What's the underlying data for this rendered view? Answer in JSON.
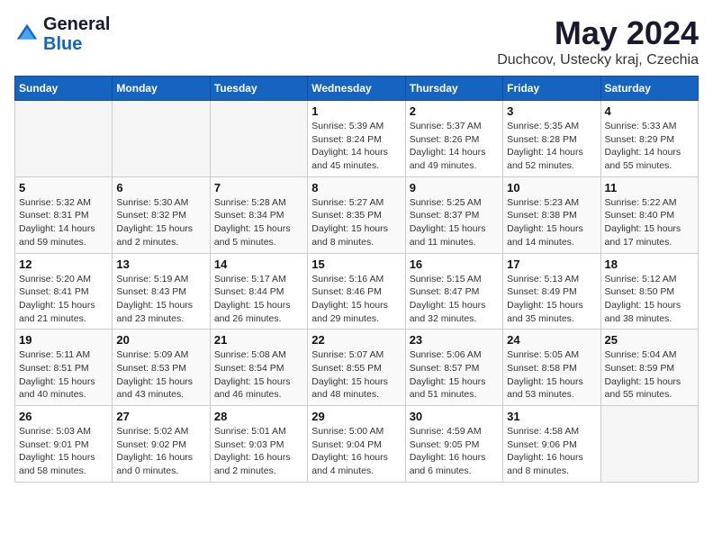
{
  "header": {
    "logo_general": "General",
    "logo_blue": "Blue",
    "month_title": "May 2024",
    "location": "Duchcov, Ustecky kraj, Czechia"
  },
  "weekdays": [
    "Sunday",
    "Monday",
    "Tuesday",
    "Wednesday",
    "Thursday",
    "Friday",
    "Saturday"
  ],
  "weeks": [
    [
      {
        "day": "",
        "sunrise": "",
        "sunset": "",
        "daylight": "",
        "empty": true
      },
      {
        "day": "",
        "sunrise": "",
        "sunset": "",
        "daylight": "",
        "empty": true
      },
      {
        "day": "",
        "sunrise": "",
        "sunset": "",
        "daylight": "",
        "empty": true
      },
      {
        "day": "1",
        "sunrise": "Sunrise: 5:39 AM",
        "sunset": "Sunset: 8:24 PM",
        "daylight": "Daylight: 14 hours and 45 minutes.",
        "empty": false
      },
      {
        "day": "2",
        "sunrise": "Sunrise: 5:37 AM",
        "sunset": "Sunset: 8:26 PM",
        "daylight": "Daylight: 14 hours and 49 minutes.",
        "empty": false
      },
      {
        "day": "3",
        "sunrise": "Sunrise: 5:35 AM",
        "sunset": "Sunset: 8:28 PM",
        "daylight": "Daylight: 14 hours and 52 minutes.",
        "empty": false
      },
      {
        "day": "4",
        "sunrise": "Sunrise: 5:33 AM",
        "sunset": "Sunset: 8:29 PM",
        "daylight": "Daylight: 14 hours and 55 minutes.",
        "empty": false
      }
    ],
    [
      {
        "day": "5",
        "sunrise": "Sunrise: 5:32 AM",
        "sunset": "Sunset: 8:31 PM",
        "daylight": "Daylight: 14 hours and 59 minutes.",
        "empty": false
      },
      {
        "day": "6",
        "sunrise": "Sunrise: 5:30 AM",
        "sunset": "Sunset: 8:32 PM",
        "daylight": "Daylight: 15 hours and 2 minutes.",
        "empty": false
      },
      {
        "day": "7",
        "sunrise": "Sunrise: 5:28 AM",
        "sunset": "Sunset: 8:34 PM",
        "daylight": "Daylight: 15 hours and 5 minutes.",
        "empty": false
      },
      {
        "day": "8",
        "sunrise": "Sunrise: 5:27 AM",
        "sunset": "Sunset: 8:35 PM",
        "daylight": "Daylight: 15 hours and 8 minutes.",
        "empty": false
      },
      {
        "day": "9",
        "sunrise": "Sunrise: 5:25 AM",
        "sunset": "Sunset: 8:37 PM",
        "daylight": "Daylight: 15 hours and 11 minutes.",
        "empty": false
      },
      {
        "day": "10",
        "sunrise": "Sunrise: 5:23 AM",
        "sunset": "Sunset: 8:38 PM",
        "daylight": "Daylight: 15 hours and 14 minutes.",
        "empty": false
      },
      {
        "day": "11",
        "sunrise": "Sunrise: 5:22 AM",
        "sunset": "Sunset: 8:40 PM",
        "daylight": "Daylight: 15 hours and 17 minutes.",
        "empty": false
      }
    ],
    [
      {
        "day": "12",
        "sunrise": "Sunrise: 5:20 AM",
        "sunset": "Sunset: 8:41 PM",
        "daylight": "Daylight: 15 hours and 21 minutes.",
        "empty": false
      },
      {
        "day": "13",
        "sunrise": "Sunrise: 5:19 AM",
        "sunset": "Sunset: 8:43 PM",
        "daylight": "Daylight: 15 hours and 23 minutes.",
        "empty": false
      },
      {
        "day": "14",
        "sunrise": "Sunrise: 5:17 AM",
        "sunset": "Sunset: 8:44 PM",
        "daylight": "Daylight: 15 hours and 26 minutes.",
        "empty": false
      },
      {
        "day": "15",
        "sunrise": "Sunrise: 5:16 AM",
        "sunset": "Sunset: 8:46 PM",
        "daylight": "Daylight: 15 hours and 29 minutes.",
        "empty": false
      },
      {
        "day": "16",
        "sunrise": "Sunrise: 5:15 AM",
        "sunset": "Sunset: 8:47 PM",
        "daylight": "Daylight: 15 hours and 32 minutes.",
        "empty": false
      },
      {
        "day": "17",
        "sunrise": "Sunrise: 5:13 AM",
        "sunset": "Sunset: 8:49 PM",
        "daylight": "Daylight: 15 hours and 35 minutes.",
        "empty": false
      },
      {
        "day": "18",
        "sunrise": "Sunrise: 5:12 AM",
        "sunset": "Sunset: 8:50 PM",
        "daylight": "Daylight: 15 hours and 38 minutes.",
        "empty": false
      }
    ],
    [
      {
        "day": "19",
        "sunrise": "Sunrise: 5:11 AM",
        "sunset": "Sunset: 8:51 PM",
        "daylight": "Daylight: 15 hours and 40 minutes.",
        "empty": false
      },
      {
        "day": "20",
        "sunrise": "Sunrise: 5:09 AM",
        "sunset": "Sunset: 8:53 PM",
        "daylight": "Daylight: 15 hours and 43 minutes.",
        "empty": false
      },
      {
        "day": "21",
        "sunrise": "Sunrise: 5:08 AM",
        "sunset": "Sunset: 8:54 PM",
        "daylight": "Daylight: 15 hours and 46 minutes.",
        "empty": false
      },
      {
        "day": "22",
        "sunrise": "Sunrise: 5:07 AM",
        "sunset": "Sunset: 8:55 PM",
        "daylight": "Daylight: 15 hours and 48 minutes.",
        "empty": false
      },
      {
        "day": "23",
        "sunrise": "Sunrise: 5:06 AM",
        "sunset": "Sunset: 8:57 PM",
        "daylight": "Daylight: 15 hours and 51 minutes.",
        "empty": false
      },
      {
        "day": "24",
        "sunrise": "Sunrise: 5:05 AM",
        "sunset": "Sunset: 8:58 PM",
        "daylight": "Daylight: 15 hours and 53 minutes.",
        "empty": false
      },
      {
        "day": "25",
        "sunrise": "Sunrise: 5:04 AM",
        "sunset": "Sunset: 8:59 PM",
        "daylight": "Daylight: 15 hours and 55 minutes.",
        "empty": false
      }
    ],
    [
      {
        "day": "26",
        "sunrise": "Sunrise: 5:03 AM",
        "sunset": "Sunset: 9:01 PM",
        "daylight": "Daylight: 15 hours and 58 minutes.",
        "empty": false
      },
      {
        "day": "27",
        "sunrise": "Sunrise: 5:02 AM",
        "sunset": "Sunset: 9:02 PM",
        "daylight": "Daylight: 16 hours and 0 minutes.",
        "empty": false
      },
      {
        "day": "28",
        "sunrise": "Sunrise: 5:01 AM",
        "sunset": "Sunset: 9:03 PM",
        "daylight": "Daylight: 16 hours and 2 minutes.",
        "empty": false
      },
      {
        "day": "29",
        "sunrise": "Sunrise: 5:00 AM",
        "sunset": "Sunset: 9:04 PM",
        "daylight": "Daylight: 16 hours and 4 minutes.",
        "empty": false
      },
      {
        "day": "30",
        "sunrise": "Sunrise: 4:59 AM",
        "sunset": "Sunset: 9:05 PM",
        "daylight": "Daylight: 16 hours and 6 minutes.",
        "empty": false
      },
      {
        "day": "31",
        "sunrise": "Sunrise: 4:58 AM",
        "sunset": "Sunset: 9:06 PM",
        "daylight": "Daylight: 16 hours and 8 minutes.",
        "empty": false
      },
      {
        "day": "",
        "sunrise": "",
        "sunset": "",
        "daylight": "",
        "empty": true
      }
    ]
  ]
}
